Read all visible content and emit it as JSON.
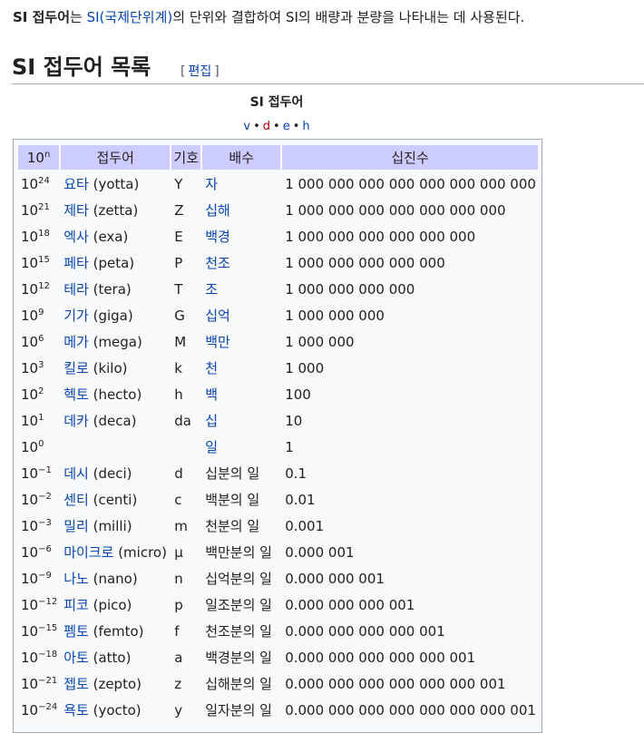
{
  "intro": {
    "term": "SI 접두어",
    "particle": "는 ",
    "link": "SI(국제단위계)",
    "rest": "의 단위와 결합하여 SI의 배량과 분량을 나타내는 데 사용된다."
  },
  "section": {
    "title": "SI 접두어 목록",
    "edit_open": "[",
    "edit_label": "편집",
    "edit_close": "]"
  },
  "navbox": {
    "title": "SI 접두어",
    "links": [
      "v",
      "d",
      "e",
      "h"
    ]
  },
  "table": {
    "headers": {
      "power_base": "10",
      "power_sup": "n",
      "prefix": "접두어",
      "symbol": "기호",
      "multiple": "배수",
      "decimal": "십진수"
    },
    "rows": [
      {
        "base": "10",
        "exp": "24",
        "prefix": "요타",
        "en": "(yotta)",
        "symbol": "Y",
        "multiple": "자",
        "decimal": "1 000 000 000 000 000 000 000 000"
      },
      {
        "base": "10",
        "exp": "21",
        "prefix": "제타",
        "en": "(zetta)",
        "symbol": "Z",
        "multiple": "십해",
        "decimal": "1 000 000 000 000 000 000 000"
      },
      {
        "base": "10",
        "exp": "18",
        "prefix": "엑사",
        "en": "(exa)",
        "symbol": "E",
        "multiple": "백경",
        "decimal": "1 000 000 000 000 000 000"
      },
      {
        "base": "10",
        "exp": "15",
        "prefix": "페타",
        "en": "(peta)",
        "symbol": "P",
        "multiple": "천조",
        "decimal": "1 000 000 000 000 000"
      },
      {
        "base": "10",
        "exp": "12",
        "prefix": "테라",
        "en": "(tera)",
        "symbol": "T",
        "multiple": "조",
        "decimal": "1 000 000 000 000"
      },
      {
        "base": "10",
        "exp": "9",
        "prefix": "기가",
        "en": "(giga)",
        "symbol": "G",
        "multiple": "십억",
        "decimal": "1 000 000 000"
      },
      {
        "base": "10",
        "exp": "6",
        "prefix": "메가",
        "en": "(mega)",
        "symbol": "M",
        "multiple": "백만",
        "decimal": "1 000 000"
      },
      {
        "base": "10",
        "exp": "3",
        "prefix": "킬로",
        "en": "(kilo)",
        "symbol": "k",
        "multiple": "천",
        "decimal": "1 000"
      },
      {
        "base": "10",
        "exp": "2",
        "prefix": "헥토",
        "en": "(hecto)",
        "symbol": "h",
        "multiple": "백",
        "decimal": "100"
      },
      {
        "base": "10",
        "exp": "1",
        "prefix": "데카",
        "en": "(deca)",
        "symbol": "da",
        "multiple": "십",
        "decimal": "10"
      },
      {
        "base": "10",
        "exp": "0",
        "prefix": "",
        "en": "",
        "symbol": "",
        "multiple": "일",
        "decimal": "1"
      },
      {
        "base": "10",
        "exp": "−1",
        "prefix": "데시",
        "en": "(deci)",
        "symbol": "d",
        "multiple": "십분의 일",
        "decimal": "0.1"
      },
      {
        "base": "10",
        "exp": "−2",
        "prefix": "센티",
        "en": "(centi)",
        "symbol": "c",
        "multiple": "백분의 일",
        "decimal": "0.01"
      },
      {
        "base": "10",
        "exp": "−3",
        "prefix": "밀리",
        "en": "(milli)",
        "symbol": "m",
        "multiple": "천분의 일",
        "decimal": "0.001"
      },
      {
        "base": "10",
        "exp": "−6",
        "prefix": "마이크로",
        "en": "(micro)",
        "symbol": "µ",
        "multiple": "백만분의 일",
        "decimal": "0.000 001"
      },
      {
        "base": "10",
        "exp": "−9",
        "prefix": "나노",
        "en": "(nano)",
        "symbol": "n",
        "multiple": "십억분의 일",
        "decimal": "0.000 000 001"
      },
      {
        "base": "10",
        "exp": "−12",
        "prefix": "피코",
        "en": "(pico)",
        "symbol": "p",
        "multiple": "일조분의 일",
        "decimal": "0.000 000 000 001"
      },
      {
        "base": "10",
        "exp": "−15",
        "prefix": "펨토",
        "en": "(femto)",
        "symbol": "f",
        "multiple": "천조분의 일",
        "decimal": "0.000 000 000 000 001"
      },
      {
        "base": "10",
        "exp": "−18",
        "prefix": "아토",
        "en": "(atto)",
        "symbol": "a",
        "multiple": "백경분의 일",
        "decimal": "0.000 000 000 000 000 001"
      },
      {
        "base": "10",
        "exp": "−21",
        "prefix": "젭토",
        "en": "(zepto)",
        "symbol": "z",
        "multiple": "십해분의 일",
        "decimal": "0.000 000 000 000 000 000 001"
      },
      {
        "base": "10",
        "exp": "−24",
        "prefix": "욕토",
        "en": "(yocto)",
        "symbol": "y",
        "multiple": "일자분의 일",
        "decimal": "0.000 000 000 000 000 000 000 001"
      }
    ]
  },
  "colors": {
    "link": "#0645ad",
    "header_bg": "#ccccff",
    "table_bg": "#f8f9fa",
    "border": "#a2a9b1"
  }
}
